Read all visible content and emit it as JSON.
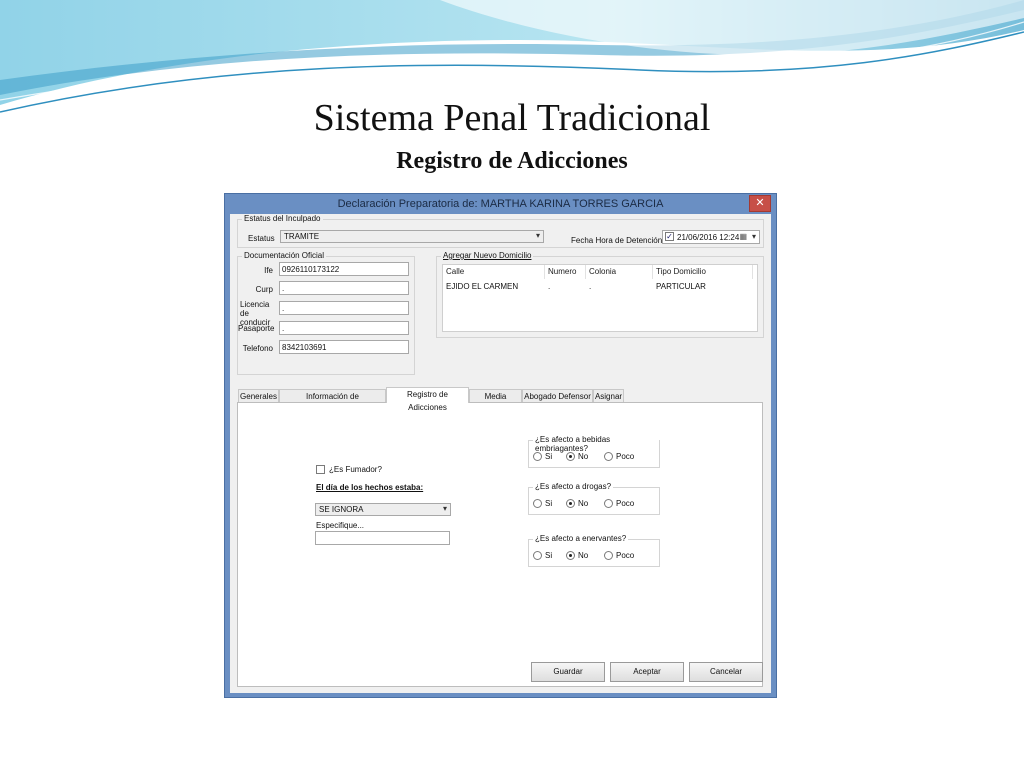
{
  "slide": {
    "title": "Sistema Penal Tradicional",
    "subtitle": "Registro de Adicciones"
  },
  "window": {
    "title": "Declaración Preparatoria de: MARTHA KARINA TORRES GARCIA",
    "close_glyph": "✕"
  },
  "estatus_group": {
    "caption": "Estatus del Inculpado",
    "estatus_label": "Estatus",
    "estatus_value": "TRAMITE",
    "fecha_label": "Fecha Hora de Detención",
    "fecha_checked": true,
    "fecha_value": "21/06/2016 12:24"
  },
  "documentacion": {
    "caption": "Documentación Oficial",
    "fields": [
      {
        "label": "Ife",
        "value": "0926110173122"
      },
      {
        "label": "Curp",
        "value": "."
      },
      {
        "label": "Licencia de conducir",
        "value": "."
      },
      {
        "label": "Pasaporte",
        "value": "."
      },
      {
        "label": "Telefono",
        "value": "8342103691"
      }
    ]
  },
  "domicilio": {
    "caption": "Agregar Nuevo Domicilio",
    "columns": [
      "Calle",
      "Numero",
      "Colonia",
      "Tipo Domicilio"
    ],
    "rows": [
      [
        "EJIDO EL CARMEN",
        ".",
        ".",
        "PARTICULAR"
      ]
    ]
  },
  "tabs": [
    {
      "label": "Generales"
    },
    {
      "label": "Información de Comparecencia"
    },
    {
      "label": "Registro de Adicciones"
    },
    {
      "label": "Media Filiación"
    },
    {
      "label": "Abogado Defensor"
    },
    {
      "label": "Asignar"
    }
  ],
  "adicciones": {
    "fumador_label": "¿Es Fumador?",
    "fumador_checked": false,
    "dia_hechos_label": "El día de los hechos estaba:",
    "dia_hechos_value": "SE IGNORA",
    "especifique_label": "Especifique...",
    "especifique_value": "",
    "questions": [
      {
        "caption": "¿Es afecto a bebidas embriagantes?",
        "options": [
          "Si",
          "No",
          "Poco"
        ],
        "selected": "No"
      },
      {
        "caption": "¿Es afecto a drogas?",
        "options": [
          "Si",
          "No",
          "Poco"
        ],
        "selected": "No"
      },
      {
        "caption": "¿Es afecto a enervantes?",
        "options": [
          "Si",
          "No",
          "Poco"
        ],
        "selected": "No"
      }
    ]
  },
  "buttons": {
    "guardar": "Guardar",
    "aceptar": "Aceptar",
    "cancelar": "Cancelar"
  },
  "icons": {
    "dropdown": "chevron-down-icon",
    "calendar": "calendar-icon",
    "close": "close-icon"
  },
  "colors": {
    "window_frame": "#6a8fc3",
    "close_button": "#c74f47",
    "wave_primary": "#5bb8d8"
  }
}
